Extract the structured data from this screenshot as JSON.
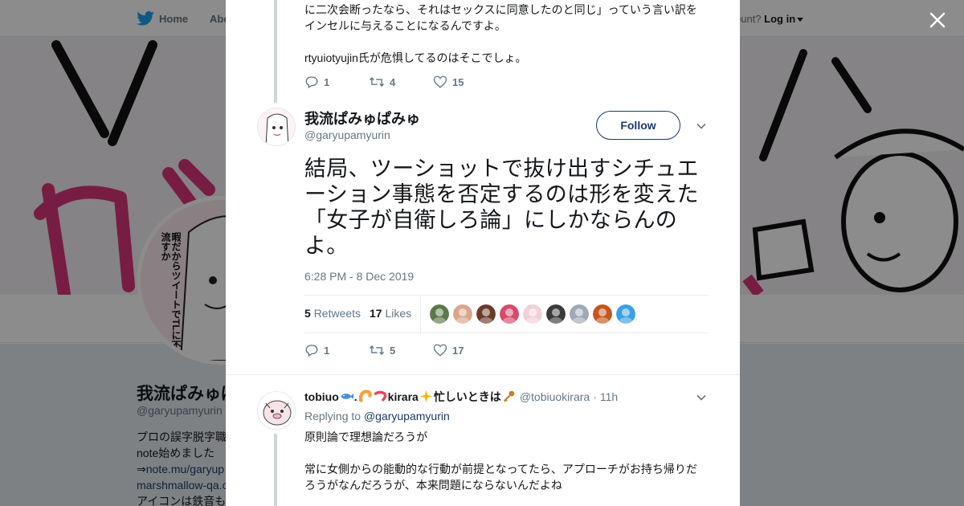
{
  "nav": {
    "home_label": "Home",
    "about_label": "Abo",
    "account_prompt": "ccount?",
    "login_label": "Log in"
  },
  "profile": {
    "name": "我流ぱみゅぱみゅ",
    "handle": "@garyupamyurin",
    "bio_line1": "プロの誤字脱字職",
    "bio_line2": "note始めました",
    "bio_line3_prefix": "⇒",
    "bio_line3_link": "note.mu/garyup",
    "bio_line4_link": "marshmallow-qa.c",
    "bio_line5": "アイコンは鉄音も",
    "avatar_text": "暇だからツイートでTLに不穏流すか"
  },
  "previous_tweet": {
    "text_line1": "に二次会断ったなら、それはセックスに同意したのと同じ」っていう言い訳を",
    "text_line2": "インセルに与えることになるんですよ。",
    "text_line3": "rtyuiotyujin氏が危惧してるのはそこでしょ。",
    "replies": "1",
    "retweets": "4",
    "likes": "15"
  },
  "main_tweet": {
    "display_name": "我流ぱみゅぱみゅ",
    "handle": "@garyupamyurin",
    "follow_label": "Follow",
    "text": "結局、ツーショットで抜け出すシチュエーション事態を否定するのは形を変えた「女子が自衛しろ論」にしかならんのよ。",
    "timestamp": "6:28 PM - 8 Dec 2019",
    "retweet_count": "5",
    "retweet_label": "Retweets",
    "like_count": "17",
    "like_label": "Likes",
    "replies": "1",
    "retweets": "5",
    "likes": "17",
    "liker_colors": [
      "#5b7a4a",
      "#d9a58b",
      "#6b3b2a",
      "#d84a6b",
      "#f2d0d8",
      "#3a3a3a",
      "#a0a8b8",
      "#c4561f",
      "#3aa0e8"
    ]
  },
  "reply_tweet": {
    "display_name_part1": "tobiuo",
    "display_name_part2": ".",
    "display_name_part3": "kirara",
    "display_name_part4": "忙しいときは",
    "handle": "@tobiuokirara",
    "time": "11h",
    "replying_to_label": "Replying to",
    "replying_to_handle": "@garyupamyurin",
    "text_line1": "原則論で理想論だろうが",
    "text_line2": "常に女側からの能動的な行動が前提となってたら、アプローチがお持ち帰りだ",
    "text_line3": "ろうがなんだろうが、本来問題にならないんだよね"
  },
  "colors": {
    "accent": "#1da1f2",
    "link": "#1b3a6b",
    "muted": "#657786",
    "banner_pink": "#e0407a"
  }
}
